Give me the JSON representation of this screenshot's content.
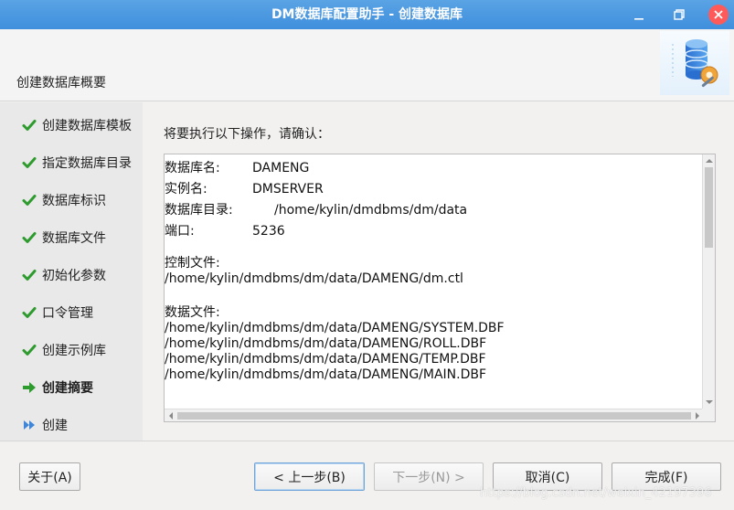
{
  "window": {
    "title": "DM数据库配置助手 - 创建数据库",
    "controls": [
      "minimize-icon",
      "restore-icon",
      "close-icon"
    ],
    "close_color": "#ff5a5a",
    "titlebar_color": "#4a97df"
  },
  "header": {
    "heading": "创建数据库概要",
    "logo_icon": "database-settings-icon"
  },
  "sidebar": {
    "steps": [
      {
        "label": "创建数据库模板",
        "state": "done"
      },
      {
        "label": "指定数据库目录",
        "state": "done"
      },
      {
        "label": "数据库标识",
        "state": "done"
      },
      {
        "label": "数据库文件",
        "state": "done"
      },
      {
        "label": "初始化参数",
        "state": "done"
      },
      {
        "label": "口令管理",
        "state": "done"
      },
      {
        "label": "创建示例库",
        "state": "done"
      },
      {
        "label": "创建摘要",
        "state": "current"
      },
      {
        "label": "创建",
        "state": "pending"
      }
    ]
  },
  "main": {
    "prompt": "将要执行以下操作，请确认：",
    "summary": {
      "fields": [
        {
          "key": "数据库名:",
          "value": "DAMENG"
        },
        {
          "key": "实例名:",
          "value": "DMSERVER"
        },
        {
          "key": "数据库目录:",
          "value": "/home/kylin/dmdbms/dm/data"
        },
        {
          "key": "端口:",
          "value": "5236"
        }
      ],
      "control_label": "控制文件:",
      "control_files": [
        "/home/kylin/dmdbms/dm/data/DAMENG/dm.ctl"
      ],
      "data_label": "数据文件:",
      "data_files": [
        "/home/kylin/dmdbms/dm/data/DAMENG/SYSTEM.DBF",
        "/home/kylin/dmdbms/dm/data/DAMENG/ROLL.DBF",
        "/home/kylin/dmdbms/dm/data/DAMENG/TEMP.DBF",
        "/home/kylin/dmdbms/dm/data/DAMENG/MAIN.DBF"
      ]
    }
  },
  "footer": {
    "about": "关于(A)",
    "back": "< 上一步(B)",
    "next": "下一步(N) >",
    "cancel": "取消(C)",
    "finish": "完成(F)"
  },
  "watermark": "https://blog.csdn.net/weixin_42197396"
}
